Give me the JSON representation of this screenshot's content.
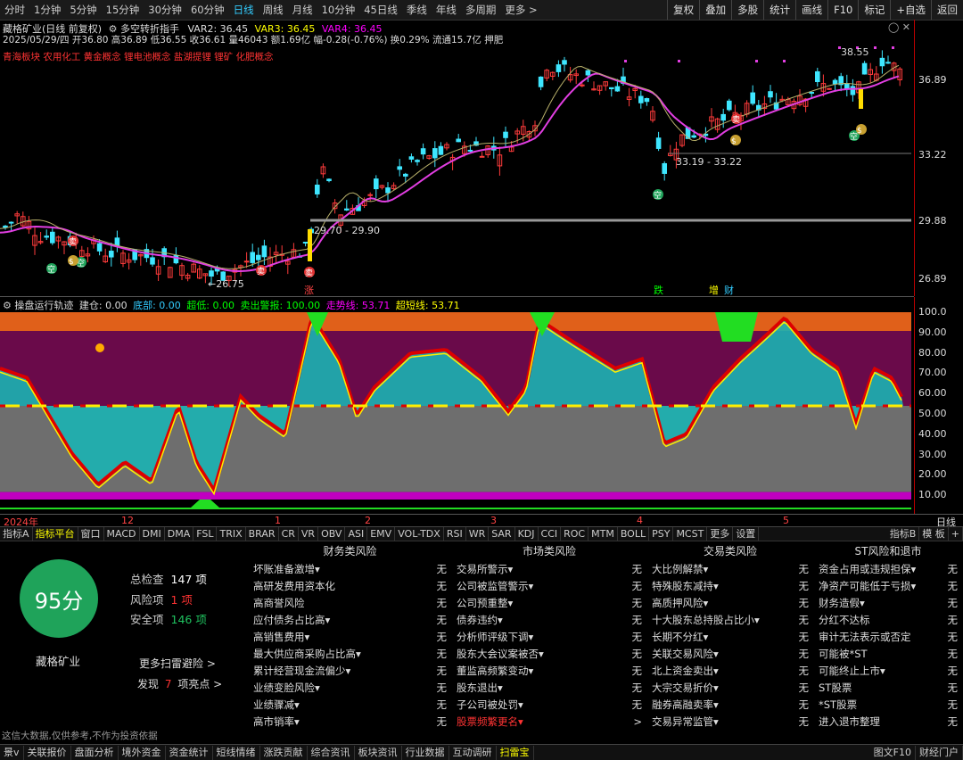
{
  "toolbar": {
    "periods": [
      "分时",
      "1分钟",
      "5分钟",
      "15分钟",
      "30分钟",
      "60分钟",
      "日线",
      "周线",
      "月线",
      "10分钟",
      "45日线",
      "季线",
      "年线",
      "多周期",
      "更多 >"
    ],
    "active_period": "日线",
    "right_buttons": [
      "复权",
      "叠加",
      "多股",
      "统计",
      "画线",
      "F10",
      "标记",
      "+自选",
      "返回"
    ]
  },
  "header": {
    "title": "藏格矿业(日线 前复权)",
    "indicator_name": "多空转折指手",
    "var2": "VAR2: 36.45",
    "var3": "VAR3: 36.45",
    "var4": "VAR4: 36.45",
    "info_line": "2025/05/29/四 开36.80 高36.89 低36.55 收36.61 量46043 额1.69亿 幅-0.28(-0.76%) 换0.29% 流通15.7亿 押肥",
    "concepts": "青海板块 农用化工 黄金概念 锂电池概念 盐湖提锂 锂矿 化肥概念"
  },
  "price_axis": [
    "36.89",
    "33.22",
    "29.88",
    "26.89"
  ],
  "annotations": {
    "high": "38.55",
    "range1": "33.19 - 33.22",
    "range2": "29.70 - 29.90",
    "low": "←26.75",
    "marker1": "涨",
    "marker2": "跌",
    "marker3": "增",
    "marker4": "财",
    "icon_buy": "买",
    "icon_sell": "卖",
    "icon_space": "空"
  },
  "indicator": {
    "title": "操盘运行轨迹",
    "build": "建仓: 0.00",
    "bottom": "底部: 0.00",
    "superlow": "超低: 0.00",
    "sell_alert": "卖出警报: 100.00",
    "trend": "走势线: 53.71",
    "short": "超短线: 53.71",
    "axis": [
      "100.0",
      "90.00",
      "80.00",
      "70.00",
      "60.00",
      "50.00",
      "40.00",
      "30.00",
      "20.00",
      "10.00"
    ]
  },
  "date_axis": [
    "2024年",
    "12",
    "1",
    "2",
    "3",
    "4",
    "5"
  ],
  "date_axis_right": "日线",
  "indicator_tabs": [
    "指标A",
    "指标平台",
    "窗口",
    "MACD",
    "DMI",
    "DMA",
    "FSL",
    "TRIX",
    "BRAR",
    "CR",
    "VR",
    "OBV",
    "ASI",
    "EMV",
    "VOL-TDX",
    "RSI",
    "WR",
    "SAR",
    "KDJ",
    "CCI",
    "ROC",
    "MTM",
    "BOLL",
    "PSY",
    "MCST",
    "更多",
    "设置"
  ],
  "indicator_tabs_right": [
    "指标B",
    "模 板",
    "+"
  ],
  "risk": {
    "score": "95分",
    "total_label": "总检查",
    "total_value": "147 项",
    "risk_label": "风险项",
    "risk_value": "1 项",
    "safe_label": "安全项",
    "safe_value": "146 项",
    "stock_name": "藏格矿业",
    "more_link": "更多扫雷避险 >",
    "highlight_prefix": "发现",
    "highlight_count": "7",
    "highlight_suffix": "项亮点 >",
    "disclaimer": "这信大数据,仅供参考,不作为投资依据",
    "columns": [
      {
        "title": "财务类风险",
        "items": [
          {
            "name": "坏账准备激增▾",
            "value": "无"
          },
          {
            "name": "高研发费用资本化",
            "value": "无"
          },
          {
            "name": "高商誉风险",
            "value": "无"
          },
          {
            "name": "应付债务占比高▾",
            "value": "无"
          },
          {
            "name": "高销售费用▾",
            "value": "无"
          },
          {
            "name": "最大供应商采购占比高▾",
            "value": "无"
          },
          {
            "name": "累计经营现金流偏少▾",
            "value": "无"
          },
          {
            "name": "业绩变脸风险▾",
            "value": "无"
          },
          {
            "name": "业绩骤减▾",
            "value": "无"
          },
          {
            "name": "高市销率▾",
            "value": "无"
          }
        ]
      },
      {
        "title": "市场类风险",
        "items": [
          {
            "name": "交易所警示▾",
            "value": "无"
          },
          {
            "name": "公司被监管警示▾",
            "value": "无"
          },
          {
            "name": "公司预重整▾",
            "value": "无"
          },
          {
            "name": "债券违约▾",
            "value": "无"
          },
          {
            "name": "分析师评级下调▾",
            "value": "无"
          },
          {
            "name": "股东大会议案被否▾",
            "value": "无"
          },
          {
            "name": "董监高频繁变动▾",
            "value": "无"
          },
          {
            "name": "股东退出▾",
            "value": "无"
          },
          {
            "name": "子公司被处罚▾",
            "value": "无"
          },
          {
            "name": "股票频繁更名▾",
            "value": ">",
            "highlight": true
          }
        ]
      },
      {
        "title": "交易类风险",
        "items": [
          {
            "name": "大比例解禁▾",
            "value": "无"
          },
          {
            "name": "特殊股东减持▾",
            "value": "无"
          },
          {
            "name": "高质押风险▾",
            "value": "无"
          },
          {
            "name": "十大股东总持股占比小▾",
            "value": "无"
          },
          {
            "name": "长期不分红▾",
            "value": "无"
          },
          {
            "name": "关联交易风险▾",
            "value": "无"
          },
          {
            "name": "北上资金卖出▾",
            "value": "无"
          },
          {
            "name": "大宗交易折价▾",
            "value": "无"
          },
          {
            "name": "融券高融卖率▾",
            "value": "无"
          },
          {
            "name": "交易异常监管▾",
            "value": "无"
          }
        ]
      },
      {
        "title": "ST风险和退市",
        "items": [
          {
            "name": "资金占用或违规担保▾",
            "value": "无"
          },
          {
            "name": "净资产可能低于亏损▾",
            "value": "无"
          },
          {
            "name": "财务造假▾",
            "value": "无"
          },
          {
            "name": "分红不达标",
            "value": "无"
          },
          {
            "name": "审计无法表示或否定",
            "value": "无"
          },
          {
            "name": "可能被*ST",
            "value": "无"
          },
          {
            "name": "可能终止上市▾",
            "value": "无"
          },
          {
            "name": "ST股票",
            "value": "无"
          },
          {
            "name": "*ST股票",
            "value": "无"
          },
          {
            "name": "进入退市整理",
            "value": "无"
          }
        ]
      }
    ]
  },
  "status_tabs": [
    "景v",
    "关联报价",
    "盘面分析",
    "境外资金",
    "资金统计",
    "短线情绪",
    "涨跌贡献",
    "综合资讯",
    "板块资讯",
    "行业数据",
    "互动调研",
    "扫雷宝"
  ],
  "status_right": [
    "图文F10",
    "财经门户"
  ]
}
